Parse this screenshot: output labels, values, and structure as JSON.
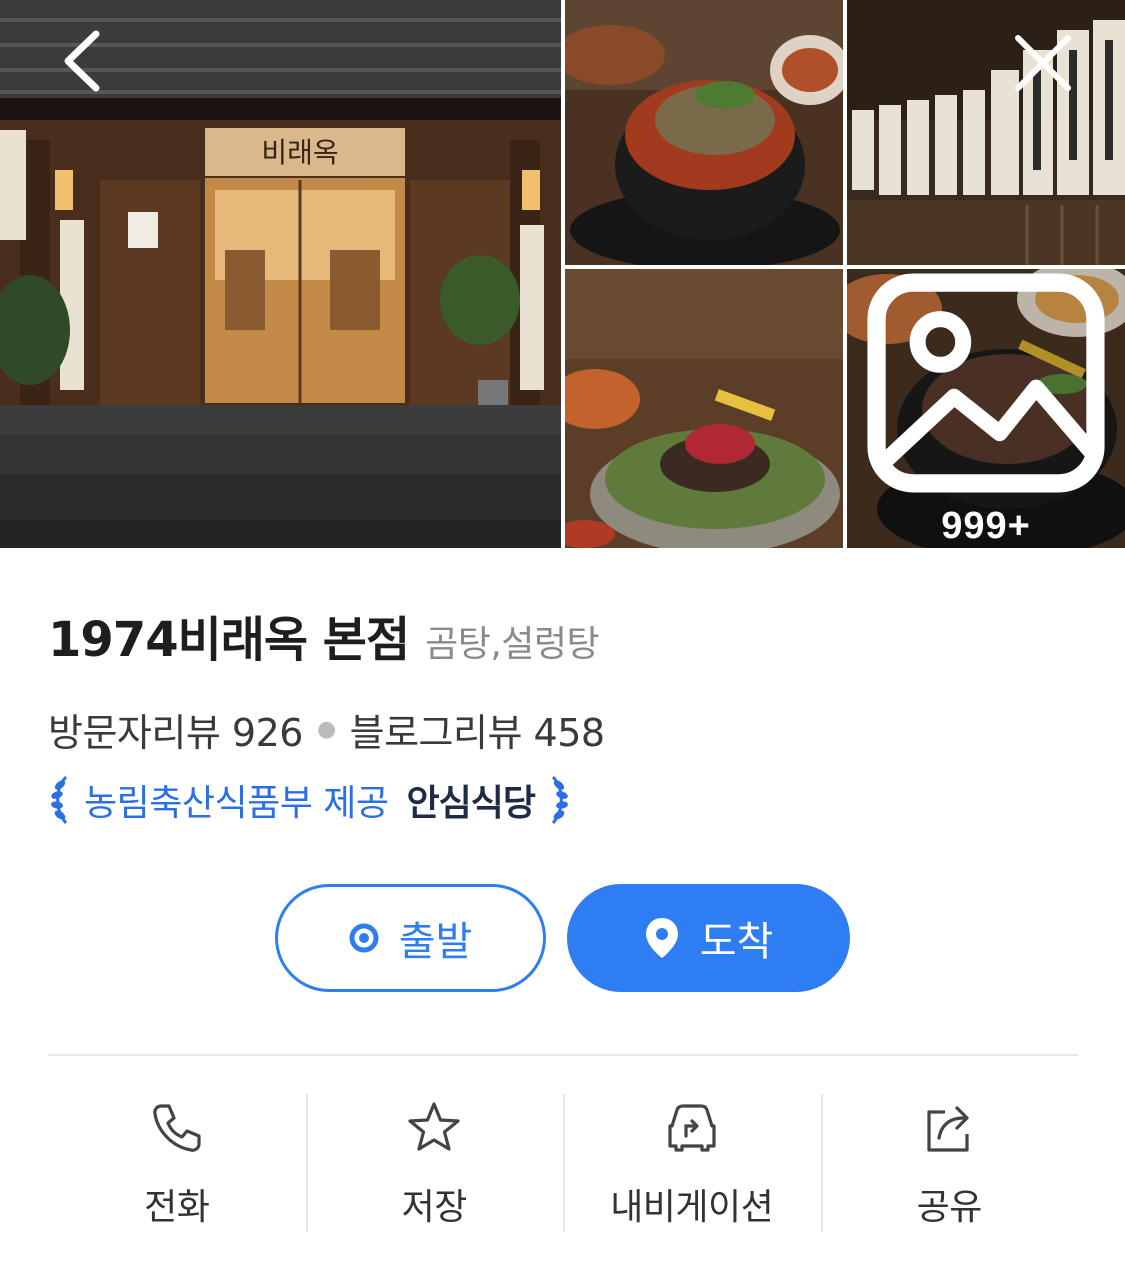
{
  "gallery": {
    "photo_count": "999+",
    "storefront_sign": "비래옥"
  },
  "place": {
    "name": "1974비래옥 본점",
    "category": "곰탕,설렁탕"
  },
  "reviews": {
    "visitor_label": "방문자리뷰",
    "visitor_count": "926",
    "blog_label": "블로그리뷰",
    "blog_count": "458"
  },
  "certification": {
    "provider": "농림축산식품부 제공",
    "badge": "안심식당"
  },
  "route": {
    "depart_label": "출발",
    "arrive_label": "도착"
  },
  "actions": [
    {
      "label": "전화",
      "icon": "phone-icon"
    },
    {
      "label": "저장",
      "icon": "star-icon"
    },
    {
      "label": "내비게이션",
      "icon": "car-navigation-icon"
    },
    {
      "label": "공유",
      "icon": "share-icon"
    }
  ],
  "colors": {
    "accent": "#2f7df2",
    "certification_text": "#2a6fe3",
    "badge_text": "#1f2a44",
    "category_text": "#8a8a8a"
  }
}
